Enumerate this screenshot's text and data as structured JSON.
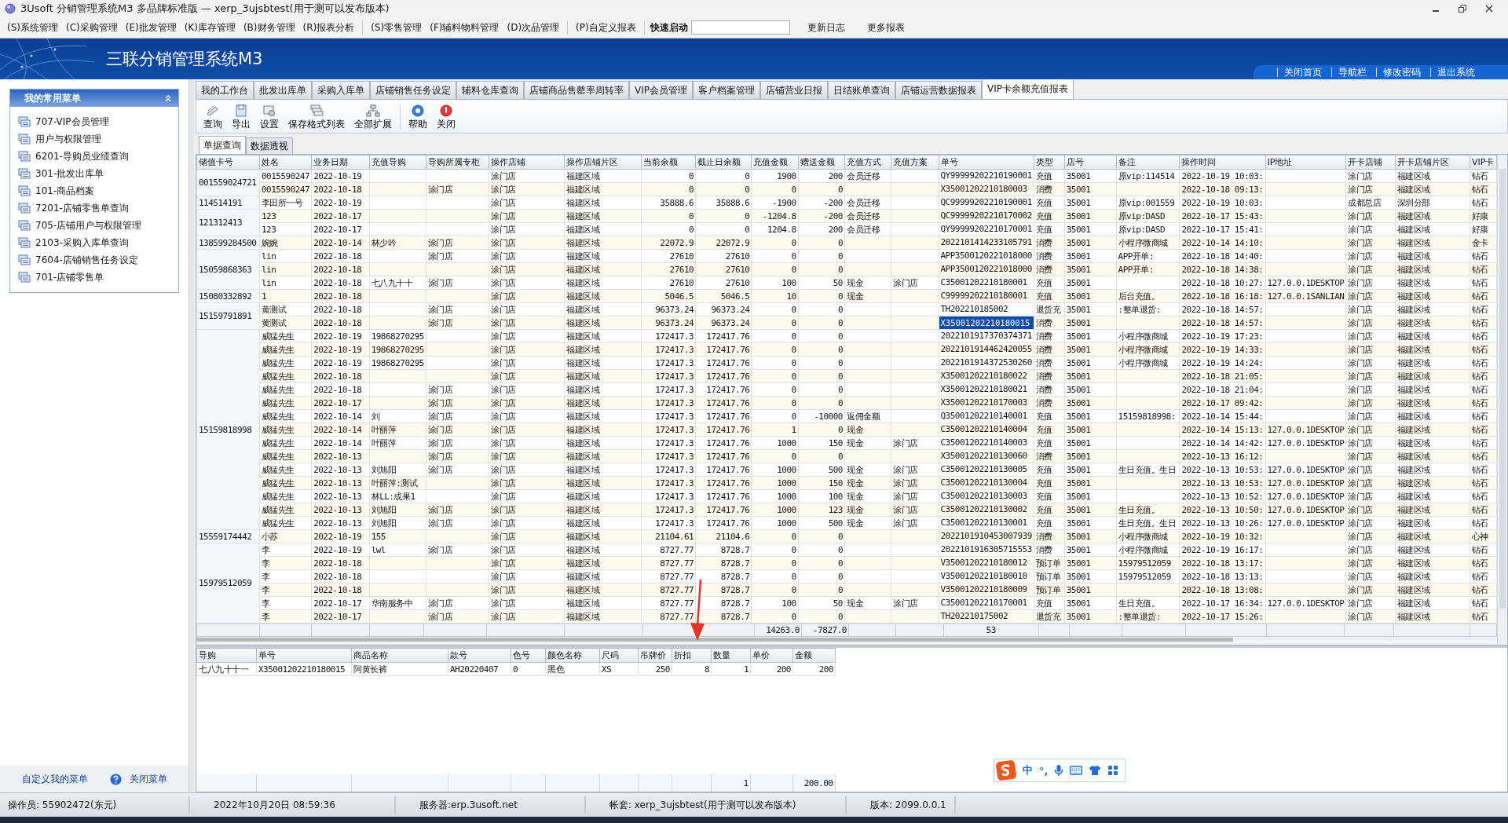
{
  "window": {
    "title": "3Usoft 分销管理系统M3 多品牌标准版 — xerp_3ujsbtest(用于测可以发布版本)"
  },
  "menu": [
    "(S)系统管理",
    "(C)采购管理",
    "(E)批发管理",
    "(K)库存管理",
    "(B)财务管理",
    "(R)报表分析",
    "(S)零售管理",
    "(F)辅料物料管理",
    "(D)次品管理",
    "(P)自定义报表"
  ],
  "quick_launch": {
    "label": "快速启动"
  },
  "menu_links": [
    "更新日志",
    "更多报表"
  ],
  "banner": {
    "title": "三联分销管理系统M3",
    "links": [
      "关闭首页",
      "导航栏",
      "修改密码",
      "退出系统"
    ]
  },
  "sidebar": {
    "title": "我的常用菜单",
    "items": [
      "707-VIP会员管理",
      "用户与权限管理",
      "6201-导购员业绩查询",
      "301-批发出库单",
      "101-商品档案",
      "7201-店铺零售单查询",
      "705-店铺用户与权限管理",
      "2103-采购入库单查询",
      "7604-店铺销售任务设定",
      "701-店铺零售单"
    ],
    "footer_links": [
      "自定义我的菜单",
      "关闭菜单"
    ]
  },
  "tabs": [
    {
      "label": "我的工作台",
      "selected": false
    },
    {
      "label": "批发出库单",
      "selected": false
    },
    {
      "label": "采购入库单",
      "selected": false
    },
    {
      "label": "店铺销售任务设定",
      "selected": false
    },
    {
      "label": "辅料仓库查询",
      "selected": false
    },
    {
      "label": "店铺商品售罄率周转率",
      "selected": false
    },
    {
      "label": "VIP会员管理",
      "selected": false
    },
    {
      "label": "客户档案管理",
      "selected": false
    },
    {
      "label": "店铺营业日报",
      "selected": false
    },
    {
      "label": "日结账单查询",
      "selected": false
    },
    {
      "label": "店铺运营数据报表",
      "selected": false
    },
    {
      "label": "VIP卡余额充值报表",
      "selected": true
    }
  ],
  "toolbar": [
    {
      "label": "查询",
      "kind": "query"
    },
    {
      "label": "导出",
      "kind": "export"
    },
    {
      "label": "设置",
      "kind": "settings"
    },
    {
      "label": "保存格式列表",
      "kind": "layout"
    },
    {
      "label": "全部扩展",
      "kind": "expand"
    },
    {
      "label": "帮助",
      "kind": "help"
    },
    {
      "label": "关闭",
      "kind": "close"
    }
  ],
  "subtabs": [
    {
      "label": "单据查询",
      "selected": true
    },
    {
      "label": "数据透视",
      "selected": false
    }
  ],
  "table": {
    "columns": [
      {
        "label": "储值卡号"
      },
      {
        "label": "姓名"
      },
      {
        "label": "业务日期"
      },
      {
        "label": "充值导购"
      },
      {
        "label": "导购所属专柜"
      },
      {
        "label": "操作店铺"
      },
      {
        "label": "操作店铺片区"
      },
      {
        "label": "当前余额"
      },
      {
        "label": "截止日余额"
      },
      {
        "label": "充值金额",
        "total": "14263.0"
      },
      {
        "label": "赠送金额",
        "total": "-7827.0"
      },
      {
        "label": "充值方式"
      },
      {
        "label": "充值方案"
      },
      {
        "label": "单号",
        "total": "53"
      },
      {
        "label": "类型"
      },
      {
        "label": "店号"
      },
      {
        "label": "备注"
      },
      {
        "label": "操作时间"
      },
      {
        "label": "IP地址"
      },
      {
        "label": "开卡店铺"
      },
      {
        "label": "开卡店铺片区"
      },
      {
        "label": "VIP卡"
      }
    ],
    "groups": [
      {
        "card": "001559024721",
        "rows": [
          {
            "selected": false,
            "cells": [
              "0015590247",
              "2022-10-19",
              null,
              null,
              "涂门店",
              "福建区域",
              "0",
              "0",
              "1900",
              "200",
              "会员迁移",
              null,
              "QY99999202210190001",
              "充值",
              "35001",
              "原vip:114514",
              "2022-10-19 10:03:",
              null,
              "涂门店",
              "福建区域",
              "钻石"
            ]
          },
          {
            "selected": false,
            "cells": [
              "0015590247",
              "2022-10-18",
              null,
              "涂门店",
              "涂门店",
              "福建区域",
              "0",
              "0",
              "0",
              "0",
              null,
              null,
              "X35001202210180003",
              "消费",
              "35001",
              null,
              "2022-10-18 09:13:",
              null,
              "涂门店",
              "福建区域",
              "钻石"
            ]
          }
        ]
      },
      {
        "card": "114514191",
        "rows": [
          {
            "selected": false,
            "cells": [
              "李田所一号",
              "2022-10-19",
              null,
              null,
              "涂门店",
              "福建区域",
              "35888.6",
              "35888.6",
              "-1900",
              "-200",
              "会员迁移",
              null,
              "QC99999202210190001",
              "充值",
              "35001",
              "原vip:001559",
              "2022-10-19 10:03:",
              null,
              "成都总店",
              "深圳分部",
              "钻石"
            ]
          }
        ]
      },
      {
        "card": "121312413",
        "rows": [
          {
            "selected": false,
            "cells": [
              "123",
              "2022-10-17",
              null,
              null,
              "涂门店",
              "福建区域",
              "0",
              "0",
              "-1204.8",
              "-200",
              "会员迁移",
              null,
              "QC99999202210170002",
              "充值",
              "35001",
              "原vip:DASD",
              "2022-10-17 15:43:",
              null,
              "涂门店",
              "福建区域",
              "好康"
            ]
          },
          {
            "selected": false,
            "cells": [
              "123",
              "2022-10-17",
              null,
              null,
              "涂门店",
              "福建区域",
              "0",
              "0",
              "1204.8",
              "200",
              "会员迁移",
              null,
              "QY99999202210170001",
              "充值",
              "35001",
              "原vip:DASD",
              "2022-10-17 15:41:",
              null,
              "涂门店",
              "福建区域",
              "好康"
            ]
          }
        ]
      },
      {
        "card": "138599284500",
        "rows": [
          {
            "selected": false,
            "cells": [
              "婉婉",
              "2022-10-14",
              "林少吟",
              "涂门店",
              "涂门店",
              "福建区域",
              "22072.9",
              "22072.9",
              "0",
              "0",
              null,
              null,
              "2022101414233105791",
              "消费",
              "35001",
              "小程序微商城",
              "2022-10-14 14:10:",
              null,
              "涂门店",
              "福建区域",
              "金卡"
            ]
          }
        ]
      },
      {
        "card": "15059868363",
        "rows": [
          {
            "selected": false,
            "cells": [
              "lin",
              "2022-10-18",
              null,
              "涂门店",
              "涂门店",
              "福建区域",
              "27610",
              "27610",
              "0",
              "0",
              null,
              null,
              "APP3500120221018000",
              "消费",
              "35001",
              "APP开单:",
              "2022-10-18 14:40:",
              null,
              "涂门店",
              "福建区域",
              "钻石"
            ]
          },
          {
            "selected": false,
            "cells": [
              "lin",
              "2022-10-18",
              null,
              null,
              "涂门店",
              "福建区域",
              "27610",
              "27610",
              "0",
              "0",
              null,
              null,
              "APP3500120221018000",
              "消费",
              "35001",
              "APP开单:",
              "2022-10-18 14:38:",
              null,
              "涂门店",
              "福建区域",
              "钻石"
            ]
          },
          {
            "selected": false,
            "cells": [
              "lin",
              "2022-10-18",
              "七八九十十",
              "涂门店",
              "涂门店",
              "福建区域",
              "27610",
              "27610",
              "100",
              "50",
              "现金",
              "涂门店",
              "C35001202210180001",
              "充值",
              "35001",
              null,
              "2022-10-18 10:27:",
              "127.0.0.1DESKTOP",
              "涂门店",
              "福建区域",
              "钻石"
            ]
          }
        ]
      },
      {
        "card": "15080332892",
        "rows": [
          {
            "selected": false,
            "cells": [
              "1",
              "2022-10-18",
              null,
              null,
              "涂门店",
              "福建区域",
              "5046.5",
              "5046.5",
              "10",
              "0",
              "现金",
              null,
              "C99999202210180001",
              "充值",
              "35001",
              "后台充值。",
              "2022-10-18 16:18:",
              "127.0.0.1SANLIAN",
              "涂门店",
              "福建区域",
              "钻石"
            ]
          }
        ]
      },
      {
        "card": "15159791891",
        "rows": [
          {
            "selected": false,
            "cells": [
              "黄测试",
              "2022-10-18",
              null,
              "涂门店",
              "涂门店",
              "福建区域",
              "96373.24",
              "96373.24",
              "0",
              "0",
              null,
              null,
              "TH202210185002",
              "退货充",
              "35001",
              ":整单退货:",
              "2022-10-18 14:57:",
              null,
              "涂门店",
              "福建区域",
              "钻石"
            ]
          },
          {
            "selected": true,
            "cells": [
              "黄测试",
              "2022-10-18",
              null,
              "涂门店",
              "涂门店",
              "福建区域",
              "96373.24",
              "96373.24",
              "0",
              "0",
              null,
              null,
              "X35001202210180015",
              "消费",
              "35001",
              null,
              "2022-10-18 14:57:",
              null,
              "涂门店",
              "福建区域",
              "钻石"
            ]
          }
        ]
      },
      {
        "card": "15159818998",
        "rows": [
          {
            "selected": false,
            "cells": [
              "威猛先生",
              "2022-10-19",
              "19868270295",
              null,
              "涂门店",
              "福建区域",
              "172417.3",
              "172417.76",
              "0",
              "0",
              null,
              null,
              "2022101917370374371",
              "消费",
              "35001",
              "小程序微商城",
              "2022-10-19 17:23:",
              null,
              "涂门店",
              "福建区域",
              "钻石"
            ]
          },
          {
            "selected": false,
            "cells": [
              "威猛先生",
              "2022-10-19",
              "19868270295",
              null,
              "涂门店",
              "福建区域",
              "172417.3",
              "172417.76",
              "0",
              "0",
              null,
              null,
              "2022101914462420055",
              "消费",
              "35001",
              "小程序微商城",
              "2022-10-19 14:33:",
              null,
              "涂门店",
              "福建区域",
              "钻石"
            ]
          },
          {
            "selected": false,
            "cells": [
              "威猛先生",
              "2022-10-19",
              "19868270295",
              null,
              "涂门店",
              "福建区域",
              "172417.3",
              "172417.76",
              "0",
              "0",
              null,
              null,
              "2022101914372530260",
              "消费",
              "35001",
              "小程序微商城",
              "2022-10-19 14:24:",
              null,
              "涂门店",
              "福建区域",
              "钻石"
            ]
          },
          {
            "selected": false,
            "cells": [
              "威猛先生",
              "2022-10-18",
              null,
              null,
              "涂门店",
              "福建区域",
              "172417.3",
              "172417.76",
              "0",
              "0",
              null,
              null,
              "X35001202210180022",
              "消费",
              "35001",
              null,
              "2022-10-18 21:05:",
              null,
              "涂门店",
              "福建区域",
              "钻石"
            ]
          },
          {
            "selected": false,
            "cells": [
              "威猛先生",
              "2022-10-18",
              null,
              "涂门店",
              "涂门店",
              "福建区域",
              "172417.3",
              "172417.76",
              "0",
              "0",
              null,
              null,
              "X35001202210180021",
              "消费",
              "35001",
              null,
              "2022-10-18 21:04:",
              null,
              "涂门店",
              "福建区域",
              "钻石"
            ]
          },
          {
            "selected": false,
            "cells": [
              "威猛先生",
              "2022-10-17",
              null,
              "涂门店",
              "涂门店",
              "福建区域",
              "172417.3",
              "172417.76",
              "0",
              "0",
              null,
              null,
              "X35001202210170003",
              "消费",
              "35001",
              null,
              "2022-10-17 09:42:",
              null,
              "涂门店",
              "福建区域",
              "钻石"
            ]
          },
          {
            "selected": false,
            "cells": [
              "威猛先生",
              "2022-10-14",
              "刘",
              "涂门店",
              "涂门店",
              "福建区域",
              "172417.3",
              "172417.76",
              "0",
              "-10000",
              "返佣金额",
              null,
              "Q35001202210140001",
              "充值",
              "35001",
              "15159818998:",
              "2022-10-14 15:44:",
              null,
              "涂门店",
              "福建区域",
              "钻石"
            ]
          },
          {
            "selected": false,
            "cells": [
              "威猛先生",
              "2022-10-14",
              "叶丽萍",
              "涂门店",
              "涂门店",
              "福建区域",
              "172417.3",
              "172417.76",
              "1",
              "0",
              "现金",
              null,
              "C35001202210140004",
              "充值",
              "35001",
              null,
              "2022-10-14 15:13:",
              "127.0.0.1DESKTOP",
              "涂门店",
              "福建区域",
              "钻石"
            ]
          },
          {
            "selected": false,
            "cells": [
              "威猛先生",
              "2022-10-14",
              "叶丽萍",
              "涂门店",
              "涂门店",
              "福建区域",
              "172417.3",
              "172417.76",
              "1000",
              "150",
              "现金",
              "涂门店",
              "C35001202210140003",
              "充值",
              "35001",
              null,
              "2022-10-14 14:42:",
              "127.0.0.1DESKTOP",
              "涂门店",
              "福建区域",
              "钻石"
            ]
          },
          {
            "selected": false,
            "cells": [
              "威猛先生",
              "2022-10-13",
              null,
              "涂门店",
              "涂门店",
              "福建区域",
              "172417.3",
              "172417.76",
              "0",
              "0",
              null,
              null,
              "X35001202210130060",
              "消费",
              "35001",
              null,
              "2022-10-13 16:12:",
              null,
              "涂门店",
              "福建区域",
              "钻石"
            ]
          },
          {
            "selected": false,
            "cells": [
              "威猛先生",
              "2022-10-13",
              "刘旭阳",
              "涂门店",
              "涂门店",
              "福建区域",
              "172417.3",
              "172417.76",
              "1000",
              "500",
              "现金",
              "涂门店",
              "C35001202210130005",
              "充值",
              "35001",
              "生日充值。生日",
              "2022-10-13 10:53:",
              "127.0.0.1DESKTOP",
              "涂门店",
              "福建区域",
              "钻石"
            ]
          },
          {
            "selected": false,
            "cells": [
              "威猛先生",
              "2022-10-13",
              "叶丽萍:测试",
              null,
              "涂门店",
              "福建区域",
              "172417.3",
              "172417.76",
              "1000",
              "150",
              "现金",
              "涂门店",
              "C35001202210130004",
              "充值",
              "35001",
              null,
              "2022-10-13 10:53:",
              "127.0.0.1DESKTOP",
              "涂门店",
              "福建区域",
              "钻石"
            ]
          },
          {
            "selected": false,
            "cells": [
              "威猛先生",
              "2022-10-13",
              "林LL:成果1",
              null,
              "涂门店",
              "福建区域",
              "172417.3",
              "172417.76",
              "1000",
              "100",
              "现金",
              "涂门店",
              "C35001202210130003",
              "充值",
              "35001",
              null,
              "2022-10-13 10:52:",
              "127.0.0.1DESKTOP",
              "涂门店",
              "福建区域",
              "钻石"
            ]
          },
          {
            "selected": false,
            "cells": [
              "威猛先生",
              "2022-10-13",
              "刘旭阳",
              "涂门店",
              "涂门店",
              "福建区域",
              "172417.3",
              "172417.76",
              "1000",
              "123",
              "现金",
              "涂门店",
              "C35001202210130002",
              "充值",
              "35001",
              "生日充值。",
              "2022-10-13 10:50:",
              "127.0.0.1DESKTOP",
              "涂门店",
              "福建区域",
              "钻石"
            ]
          },
          {
            "selected": false,
            "cells": [
              "威猛先生",
              "2022-10-13",
              "刘旭阳",
              "涂门店",
              "涂门店",
              "福建区域",
              "172417.3",
              "172417.76",
              "1000",
              "500",
              "现金",
              "涂门店",
              "C35001202210130001",
              "充值",
              "35001",
              "生日充值。生日",
              "2022-10-13 10:26:",
              "127.0.0.1DESKTOP",
              "涂门店",
              "福建区域",
              "钻石"
            ]
          }
        ]
      },
      {
        "card": "15559174442",
        "rows": [
          {
            "selected": false,
            "cells": [
              "小苏",
              "2022-10-19",
              "155",
              null,
              "涂门店",
              "福建区域",
              "21104.61",
              "21104.6",
              "0",
              "0",
              null,
              null,
              "2022101910453007939",
              "消费",
              "35001",
              "小程序微商城",
              "2022-10-19 10:32:",
              null,
              "涂门店",
              "福建区域",
              "心神"
            ]
          }
        ]
      },
      {
        "card": "15979512059",
        "rows": [
          {
            "selected": false,
            "cells": [
              "李",
              "2022-10-19",
              "lwl",
              "涂门店",
              "涂门店",
              "福建区域",
              "8727.77",
              "8728.7",
              "0",
              "0",
              null,
              null,
              "2022101916305715553",
              "消费",
              "35001",
              "小程序微商城",
              "2022-10-19 16:17:",
              null,
              "涂门店",
              "福建区域",
              "钻石"
            ]
          },
          {
            "selected": false,
            "cells": [
              "李",
              "2022-10-18",
              null,
              null,
              "涂门店",
              "福建区域",
              "8727.77",
              "8728.7",
              "0",
              "0",
              null,
              null,
              "V35001202210180012",
              "预订单",
              "35001",
              "15979512059",
              "2022-10-18 13:17:",
              null,
              "涂门店",
              "福建区域",
              "钻石"
            ]
          },
          {
            "selected": false,
            "cells": [
              "李",
              "2022-10-18",
              null,
              null,
              "涂门店",
              "福建区域",
              "8727.77",
              "8728.7",
              "0",
              "0",
              null,
              null,
              "V35001202210180010",
              "预订单",
              "35001",
              "15979512059",
              "2022-10-18 13:13:",
              null,
              "涂门店",
              "福建区域",
              "钻石"
            ]
          },
          {
            "selected": false,
            "cells": [
              "李",
              "2022-10-18",
              null,
              null,
              "涂门店",
              "福建区域",
              "8727.77",
              "8728.7",
              "0",
              "0",
              null,
              null,
              "V35001202210180009",
              "预订单",
              "35001",
              null,
              "2022-10-18 13:08:",
              null,
              "涂门店",
              "福建区域",
              "钻石"
            ]
          },
          {
            "selected": false,
            "cells": [
              "李",
              "2022-10-17",
              "华南服务中",
              "涂门店",
              "涂门店",
              "福建区域",
              "8727.77",
              "8728.7",
              "100",
              "50",
              "现金",
              "涂门店",
              "C35001202210170001",
              "充值",
              "35001",
              "生日充值。",
              "2022-10-17 16:34:",
              "127.0.0.1DESKTOP",
              "涂门店",
              "福建区域",
              "钻石"
            ]
          },
          {
            "selected": false,
            "cells": [
              "李",
              "2022-10-17",
              null,
              "涂门店",
              "涂门店",
              "福建区域",
              "8727.77",
              "8728.7",
              "0",
              "0",
              null,
              null,
              "TH202210175002",
              "退货充",
              "35001",
              ":整单退货:",
              "2022-10-17 15:26:",
              null,
              "涂门店",
              "福建区域",
              "钻石"
            ]
          }
        ]
      }
    ]
  },
  "detail": {
    "columns": [
      {
        "label": "导购"
      },
      {
        "label": "单号"
      },
      {
        "label": "商品名称"
      },
      {
        "label": "款号"
      },
      {
        "label": "色号"
      },
      {
        "label": "颜色名称"
      },
      {
        "label": "尺码"
      },
      {
        "label": "吊牌价"
      },
      {
        "label": "折扣"
      },
      {
        "label": "数量",
        "total": "1"
      },
      {
        "label": "单价"
      },
      {
        "label": "金额",
        "total": "200.00"
      }
    ],
    "rows": [
      [
        "七八九十十一",
        "X35001202210180015",
        "阿黄长裤",
        "AH20220407",
        "0",
        "黑色",
        "XS",
        "250",
        "8",
        "1",
        "200",
        "200"
      ]
    ]
  },
  "ime": {
    "mode": "中",
    "punctuation": "°,"
  },
  "status_bar": [
    "操作员: 55902472(东元)",
    "2022年10月20日 08:59:36",
    "服务器:erp.3usoft.net",
    "帐套: xerp_3ujsbtest(用于测可以发布版本)",
    "版本: 2099.0.0.1"
  ]
}
